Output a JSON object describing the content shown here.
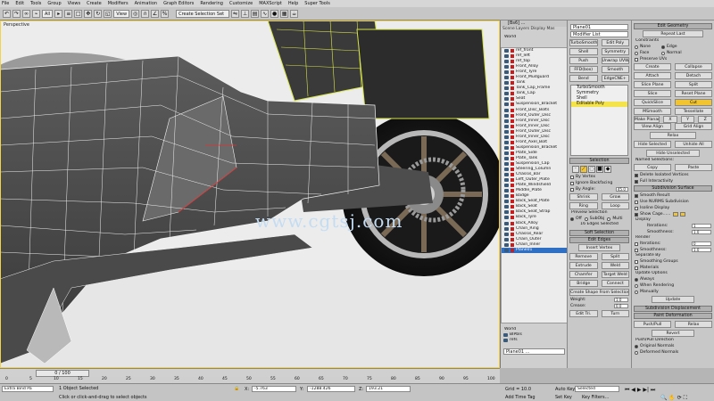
{
  "menu": [
    "File",
    "Edit",
    "Tools",
    "Group",
    "Views",
    "Create",
    "Modifiers",
    "Animation",
    "Graph Editors",
    "Rendering",
    "Customize",
    "MAXScript",
    "Help",
    "Super Tools"
  ],
  "toolbar": {
    "selection_filter": "All",
    "view_select": "View",
    "named_selection": "Create Selection Set"
  },
  "viewport": {
    "label": "Perspective",
    "watermark": "www.cgtsj.com"
  },
  "explorer": {
    "title": "[Bs6] ...",
    "tabs": "Scene Layers Display Mas",
    "root": "World",
    "items": [
      "ref_front",
      "ref_left",
      "ref_top",
      "Front_Alloy",
      "Front_Tyre",
      "Front_Mudguard",
      "Tank",
      "Tank_Cap_Frame",
      "Tank_Cap",
      "Seat",
      "Suspension_Bracket",
      "Front_Disc_Bolts",
      "Front_Outer_Disc",
      "Front_Inner_Disc",
      "Front_Inner_Disc",
      "Front_Outer_Disc",
      "Front_Inner_Disc",
      "Front_Axel_Bolt",
      "Suspension_Bracket",
      "Plate_Side",
      "Plate_Tank",
      "Suspension_Cap",
      "Steering_Column",
      "Chassis_Bar",
      "Left_Outer_Plate",
      "Plate_Windshield",
      "Middle_Plate",
      "Badge",
      "Back_Seat_Plate",
      "Back_Seat",
      "Back_Seat_Strap",
      "Back_Tyre",
      "Back_Alloy",
      "Chain_Ring",
      "Chassis_Rear",
      "Chain_Outer",
      "Chain_Inner",
      "Plane01"
    ],
    "selected_item": "Plane01",
    "bottom_root": "World",
    "bottom_items": [
      "BIPbls",
      "refs"
    ],
    "bottom_field": "Plane01 ..."
  },
  "modifier": {
    "name": "Plane01",
    "list_label": "Modifier List",
    "buttons": [
      "TurboSmooth",
      "Edit Poly",
      "Shell",
      "Symmetry",
      "Push",
      "Unwrap UVW",
      "FFD(box)",
      "Smooth",
      "Bend",
      "EdgeCNE+"
    ],
    "stack": [
      "TurboSmooth",
      "Symmetry",
      "Shell",
      "Editable Poly"
    ],
    "stack_selected": "Editable Poly",
    "selection_title": "Selection",
    "by_vertex": "By Vertex",
    "ignore_backfacing": "Ignore Backfacing",
    "by_angle": "By Angle:",
    "by_angle_value": "45.0",
    "sel_buttons": [
      "Shrink",
      "Grow",
      "Ring",
      "Loop"
    ],
    "preview_label": "Preview Selection",
    "preview_options": [
      "Off",
      "SubObj",
      "Multi"
    ],
    "status": "16 Edges Selected",
    "soft_selection": "Soft Selection",
    "edit_edges": "Edit Edges",
    "edge_buttons": [
      "Insert Vertex",
      "Remove",
      "Split",
      "Extrude",
      "Weld",
      "Chamfer",
      "Target Weld",
      "Bridge",
      "Connect"
    ],
    "create_shape": "Create Shape From Selection",
    "weight_label": "Weight:",
    "weight_value": "1.0",
    "crease_label": "Crease:",
    "crease_value": "0.0",
    "edit_tri": "Edit Tri.",
    "turn": "Turn"
  },
  "geometry": {
    "title": "Edit Geometry",
    "repeat_last": "Repeat Last",
    "constraints_label": "Constraints",
    "constraints": [
      "None",
      "Edge",
      "Face",
      "Normal"
    ],
    "preserve_uvs": "Preserve UVs",
    "btns": [
      "Create",
      "Collapse",
      "Attach",
      "Detach",
      "Slice Plane",
      "Split",
      "Slice",
      "Reset Plane",
      "QuickSlice",
      "Cut",
      "MSmooth",
      "Tessellate",
      "Make Planar",
      "X",
      "Y",
      "Z",
      "View Align",
      "Grid Align",
      "Relax",
      "Hide Selected",
      "Unhide All",
      "Hide Unselected"
    ],
    "named_sel": "Named Selections:",
    "copy": "Copy",
    "paste": "Paste",
    "delete_isolated": "Delete Isolated Vertices",
    "full_interactivity": "Full Interactivity",
    "subdivision_title": "Subdivision Surface",
    "smooth_result": "Smooth Result",
    "use_nurms": "Use NURMS Subdivision",
    "isoline": "Isoline Display",
    "show_cage": "Show Cage......",
    "display_label": "Display",
    "iterations_label": "Iterations:",
    "iterations_value": "1",
    "smoothness_label": "Smoothness:",
    "smoothness_value": "1.0",
    "render_label": "Render",
    "render_iterations": "0",
    "render_smoothness": "1.0",
    "separate_by": "Separate By",
    "smoothing_groups": "Smoothing Groups",
    "materials": "Materials",
    "update_options": "Update Options",
    "update_choices": [
      "Always",
      "When Rendering",
      "Manually"
    ],
    "update_btn": "Update",
    "subdiv_displacement": "Subdivision Displacement",
    "paint_deformation": "Paint Deformation",
    "push_pull": "Push/Pull",
    "relax": "Relax",
    "revert": "Revert",
    "push_pull_direction": "Push/Pull Direction",
    "original_normals": "Original Normals",
    "deformed_normals": "Deformed Normals"
  },
  "timeline": {
    "slider": "0 / 100",
    "ticks": [
      "0",
      "5",
      "10",
      "15",
      "20",
      "25",
      "30",
      "35",
      "40",
      "45",
      "50",
      "55",
      "60",
      "65",
      "70",
      "75",
      "80",
      "85",
      "90",
      "95",
      "100"
    ]
  },
  "status": {
    "script": "Extra Bind Pa",
    "selected": "1 Object Selected",
    "prompt": "Click or click-and-drag to select objects",
    "x_label": "X:",
    "x_value": "-5.763",
    "y_label": "Y:",
    "y_value": "-1288.426",
    "z_label": "Z:",
    "z_value": "193.21",
    "grid": "Grid = 10.0",
    "add_time_tag": "Add Time Tag",
    "auto_key": "Auto Key",
    "set_key": "Set Key",
    "selected_dd": "Selected",
    "key_filters": "Key Filters..."
  },
  "colors": {
    "accent": "#f2c530",
    "selection": "#2f6fc4",
    "object_icon": "#c22020",
    "watermark": "#c4dcf2"
  }
}
